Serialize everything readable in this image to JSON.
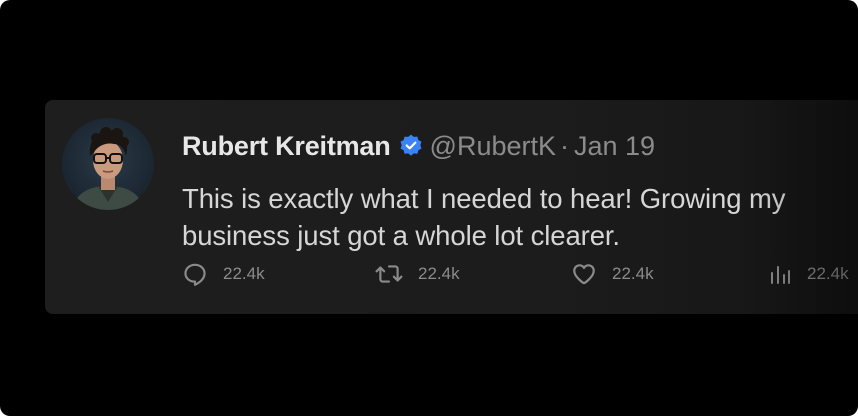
{
  "tweet": {
    "display_name": "Rubert Kreitman",
    "handle": "@RubertK",
    "separator": "·",
    "date": "Jan 19",
    "text": "This is exactly what I needed to hear! Growing my business just got a whole lot clearer.",
    "verified_color": "#3b82f6"
  },
  "actions": {
    "reply": {
      "icon": "reply-icon",
      "count": "22.4k"
    },
    "retweet": {
      "icon": "retweet-icon",
      "count": "22.4k"
    },
    "like": {
      "icon": "heart-icon",
      "count": "22.4k"
    },
    "views": {
      "icon": "views-icon",
      "count": "22.4k"
    }
  },
  "theme": {
    "background": "#000000",
    "card": "#1e1e1e",
    "text_primary": "#e7e7e7",
    "text_secondary": "#8b8b8b"
  }
}
